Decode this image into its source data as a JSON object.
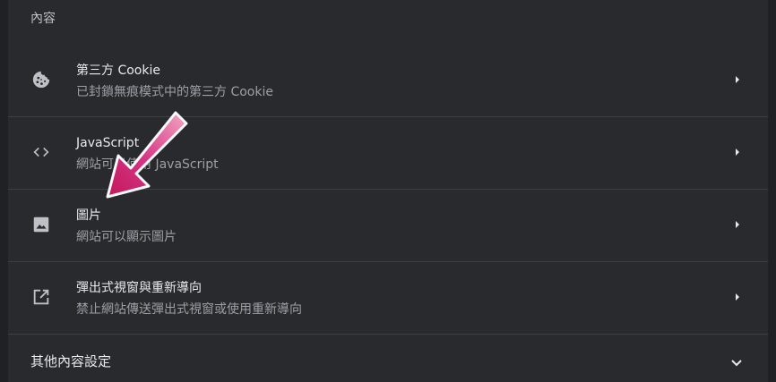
{
  "section": {
    "title": "內容"
  },
  "rows": [
    {
      "title": "第三方 Cookie",
      "subtitle": "已封鎖無痕模式中的第三方 Cookie",
      "icon": "cookie-icon"
    },
    {
      "title": "JavaScript",
      "subtitle": "網站可以使用 JavaScript",
      "icon": "code-icon"
    },
    {
      "title": "圖片",
      "subtitle": "網站可以顯示圖片",
      "icon": "image-icon"
    },
    {
      "title": "彈出式視窗與重新導向",
      "subtitle": "禁止網站傳送彈出式視窗或使用重新導向",
      "icon": "open-in-new-icon"
    }
  ],
  "footer": {
    "label": "其他內容設定",
    "icon": "chevron-down-icon"
  },
  "colors": {
    "background": "#202124",
    "card": "#292a2d",
    "divider": "#3c4043",
    "text_primary": "#e8eaed",
    "text_secondary": "#9aa0a6",
    "annotation_arrow": "#d63384"
  }
}
